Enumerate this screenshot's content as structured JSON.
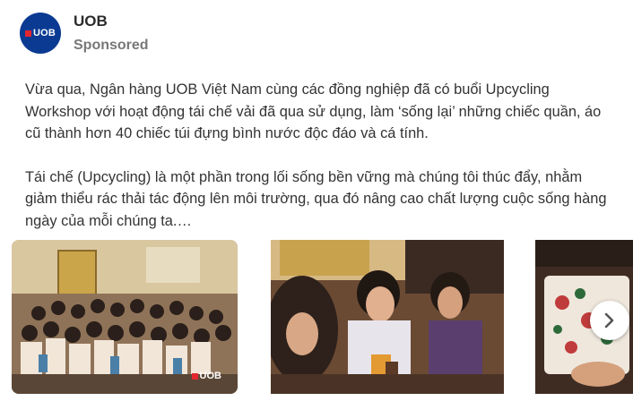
{
  "header": {
    "brand_name": "UOB",
    "sponsored_label": "Sponsored",
    "avatar_logo_text": "UOB"
  },
  "post": {
    "paragraph_1": "Vừa qua, Ngân hàng UOB Việt Nam cùng các đồng nghiệp đã có buổi Upcycling Workshop với hoạt động tái chế vải đã qua sử dụng, làm ‘sống lại’ những chiếc quần, áo cũ thành hơn 40 chiếc túi đựng bình nước độc đáo và cá tính.",
    "paragraph_2": "Tái chế (Upcycling) là một phần trong lối sống bền vững mà chúng tôi thúc đẩy, nhằm giảm thiểu rác thải tác động lên môi trường, qua đó nâng cao chất lượng cuộc sống hàng ngày của mỗi chúng ta.…"
  },
  "carousel": {
    "watermark_text": "UOB",
    "next_icon": "chevron-right-icon"
  },
  "colors": {
    "brand_blue": "#0a3a92",
    "brand_red": "#e3262d"
  }
}
